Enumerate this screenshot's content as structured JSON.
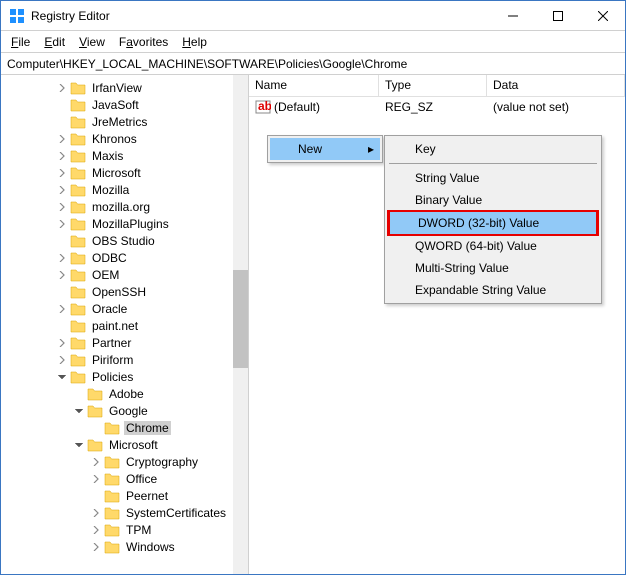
{
  "window": {
    "title": "Registry Editor"
  },
  "menu": {
    "file": "File",
    "edit": "Edit",
    "view": "View",
    "favorites": "Favorites",
    "help": "Help"
  },
  "path": "Computer\\HKEY_LOCAL_MACHINE\\SOFTWARE\\Policies\\Google\\Chrome",
  "columns": {
    "name": "Name",
    "type": "Type",
    "data": "Data"
  },
  "list": {
    "default_name": "(Default)",
    "default_type": "REG_SZ",
    "default_data": "(value not set)"
  },
  "tree": {
    "irfanview": "IrfanView",
    "javasoft": "JavaSoft",
    "jremetrics": "JreMetrics",
    "khronos": "Khronos",
    "maxis": "Maxis",
    "microsoft": "Microsoft",
    "mozilla": "Mozilla",
    "mozillaorg": "mozilla.org",
    "mozillaplugins": "MozillaPlugins",
    "obs": "OBS Studio",
    "odbc": "ODBC",
    "oem": "OEM",
    "openssh": "OpenSSH",
    "oracle": "Oracle",
    "paintnet": "paint.net",
    "partner": "Partner",
    "piriform": "Piriform",
    "policies": "Policies",
    "adobe": "Adobe",
    "google": "Google",
    "chrome": "Chrome",
    "microsoft2": "Microsoft",
    "cryptography": "Cryptography",
    "office": "Office",
    "peernet": "Peernet",
    "systemcerts": "SystemCertificates",
    "tpm": "TPM",
    "windows": "Windows"
  },
  "context": {
    "new": "New",
    "key": "Key",
    "string": "String Value",
    "binary": "Binary Value",
    "dword": "DWORD (32-bit) Value",
    "qword": "QWORD (64-bit) Value",
    "multistring": "Multi-String Value",
    "expandable": "Expandable String Value"
  }
}
